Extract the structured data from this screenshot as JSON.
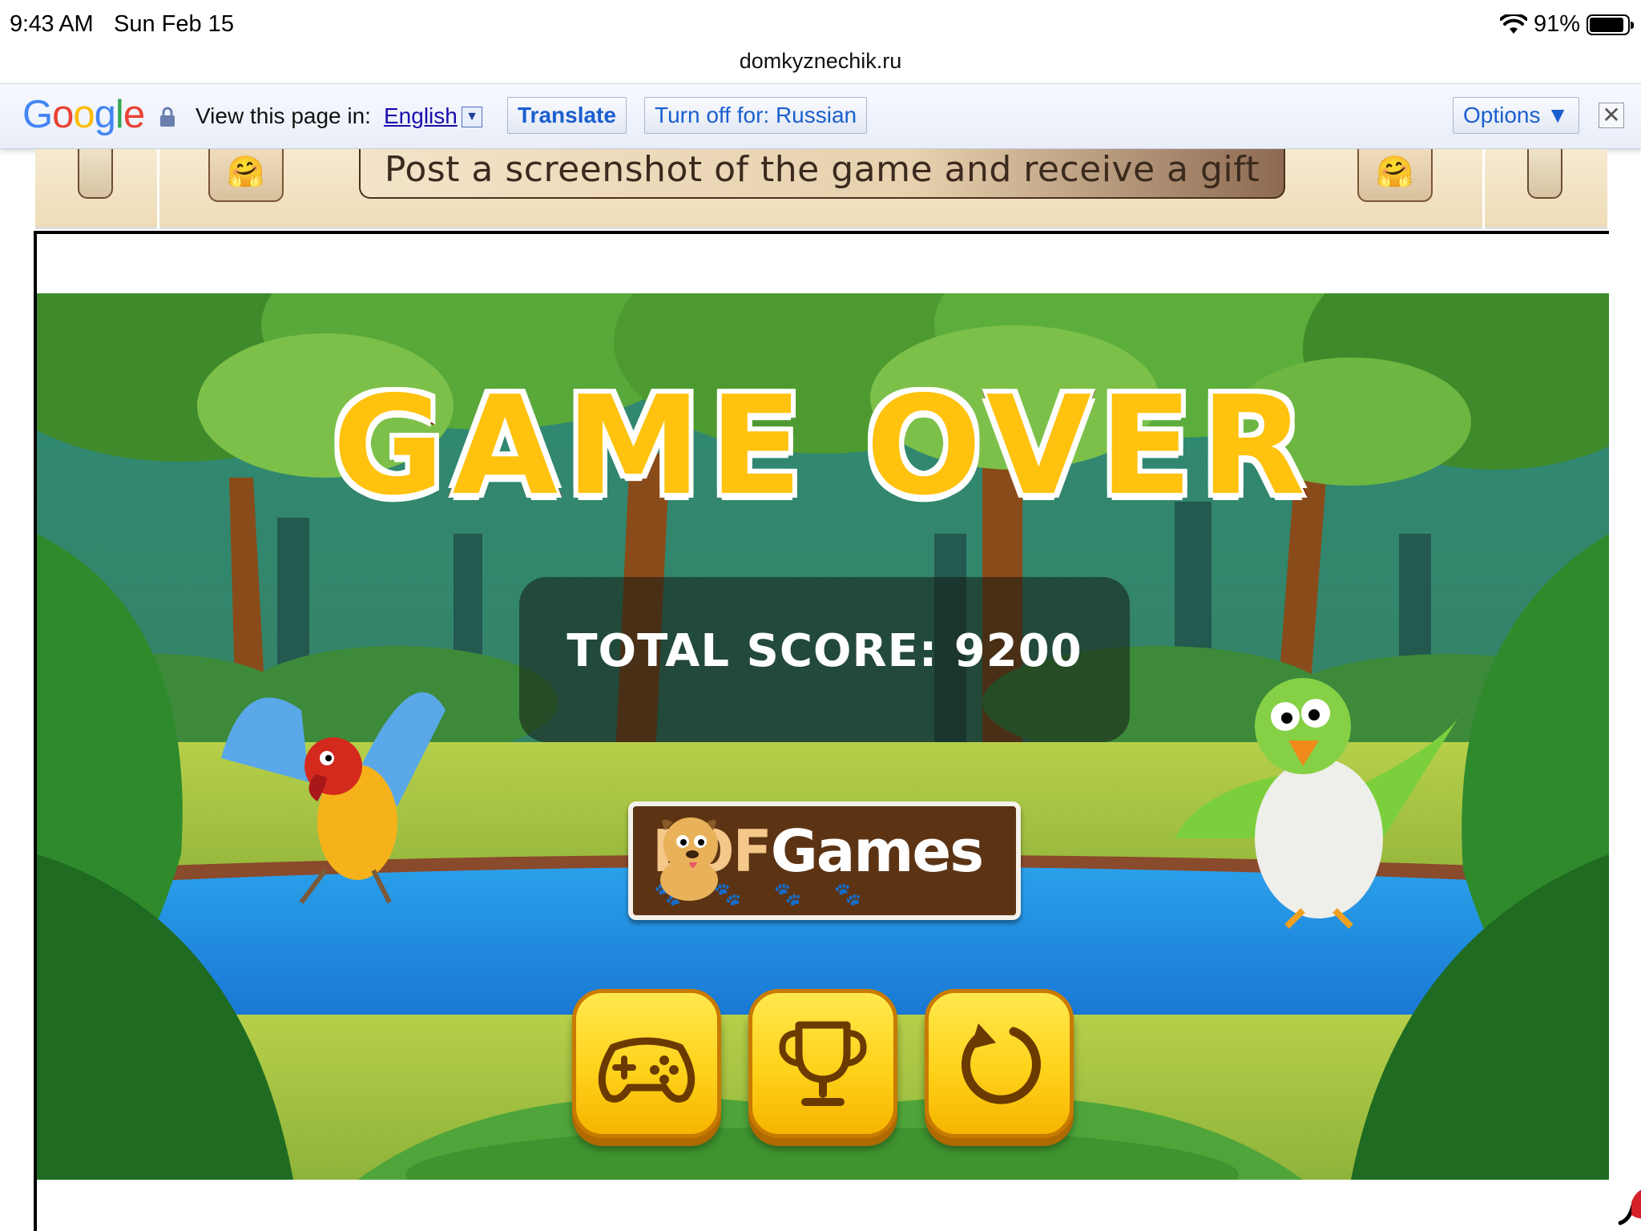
{
  "status_bar": {
    "time": "9:43 AM",
    "date": "Sun Feb 15",
    "battery": "91%",
    "battery_level": 0.91
  },
  "browser": {
    "url": "domkyznechik.ru"
  },
  "translate_bar": {
    "logo": "Google",
    "view_label": "View this page in:",
    "language": "English",
    "translate_button": "Translate",
    "turn_off_button": "Turn off for: Russian",
    "options_button": "Options ▼",
    "close_glyph": "✕"
  },
  "banner": {
    "gift_text": "Post a screenshot of the game and receive a gift",
    "emoji": "🤗"
  },
  "game": {
    "title": "GAME OVER",
    "score_text": "TOTAL SCORE: 9200",
    "logo_lof": "LOF",
    "logo_games": "Games",
    "paws": "🐾🐾🐾🐾",
    "buttons": {
      "games_icon": "gamepad-icon",
      "leaderboard_icon": "trophy-icon",
      "restart_icon": "restart-icon"
    },
    "colors": {
      "title_fill": "#ffc20e",
      "title_stroke": "#8a1f0a",
      "button_yellow": "#ffd21a",
      "logo_brown": "#5c3414"
    }
  }
}
